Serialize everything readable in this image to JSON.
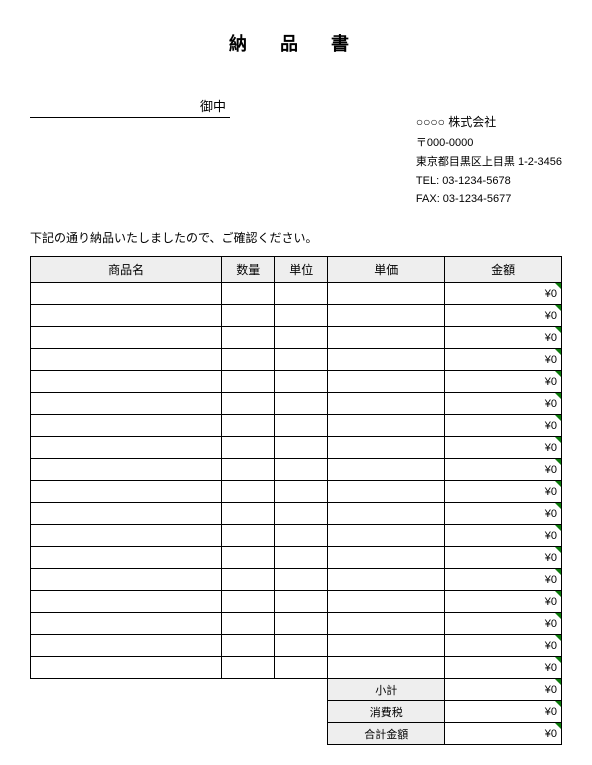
{
  "title": "納 品 書",
  "recipient_suffix": "御中",
  "company": {
    "name": "○○○○ 株式会社",
    "postal": "〒000-0000",
    "address": "東京都目黒区上目黒 1-2-3456",
    "tel": "TEL: 03-1234-5678",
    "fax": "FAX: 03-1234-5677"
  },
  "intro": "下記の通り納品いたしましたので、ご確認ください。",
  "headers": {
    "name": "商品名",
    "qty": "数量",
    "unit": "単位",
    "price": "単価",
    "amount": "金額"
  },
  "rows": [
    {
      "name": "",
      "qty": "",
      "unit": "",
      "price": "",
      "amount": "¥0"
    },
    {
      "name": "",
      "qty": "",
      "unit": "",
      "price": "",
      "amount": "¥0"
    },
    {
      "name": "",
      "qty": "",
      "unit": "",
      "price": "",
      "amount": "¥0"
    },
    {
      "name": "",
      "qty": "",
      "unit": "",
      "price": "",
      "amount": "¥0"
    },
    {
      "name": "",
      "qty": "",
      "unit": "",
      "price": "",
      "amount": "¥0"
    },
    {
      "name": "",
      "qty": "",
      "unit": "",
      "price": "",
      "amount": "¥0"
    },
    {
      "name": "",
      "qty": "",
      "unit": "",
      "price": "",
      "amount": "¥0"
    },
    {
      "name": "",
      "qty": "",
      "unit": "",
      "price": "",
      "amount": "¥0"
    },
    {
      "name": "",
      "qty": "",
      "unit": "",
      "price": "",
      "amount": "¥0"
    },
    {
      "name": "",
      "qty": "",
      "unit": "",
      "price": "",
      "amount": "¥0"
    },
    {
      "name": "",
      "qty": "",
      "unit": "",
      "price": "",
      "amount": "¥0"
    },
    {
      "name": "",
      "qty": "",
      "unit": "",
      "price": "",
      "amount": "¥0"
    },
    {
      "name": "",
      "qty": "",
      "unit": "",
      "price": "",
      "amount": "¥0"
    },
    {
      "name": "",
      "qty": "",
      "unit": "",
      "price": "",
      "amount": "¥0"
    },
    {
      "name": "",
      "qty": "",
      "unit": "",
      "price": "",
      "amount": "¥0"
    },
    {
      "name": "",
      "qty": "",
      "unit": "",
      "price": "",
      "amount": "¥0"
    },
    {
      "name": "",
      "qty": "",
      "unit": "",
      "price": "",
      "amount": "¥0"
    },
    {
      "name": "",
      "qty": "",
      "unit": "",
      "price": "",
      "amount": "¥0"
    }
  ],
  "totals": {
    "subtotal_label": "小計",
    "subtotal_value": "¥0",
    "tax_label": "消費税",
    "tax_value": "¥0",
    "total_label": "合計金額",
    "total_value": "¥0"
  }
}
